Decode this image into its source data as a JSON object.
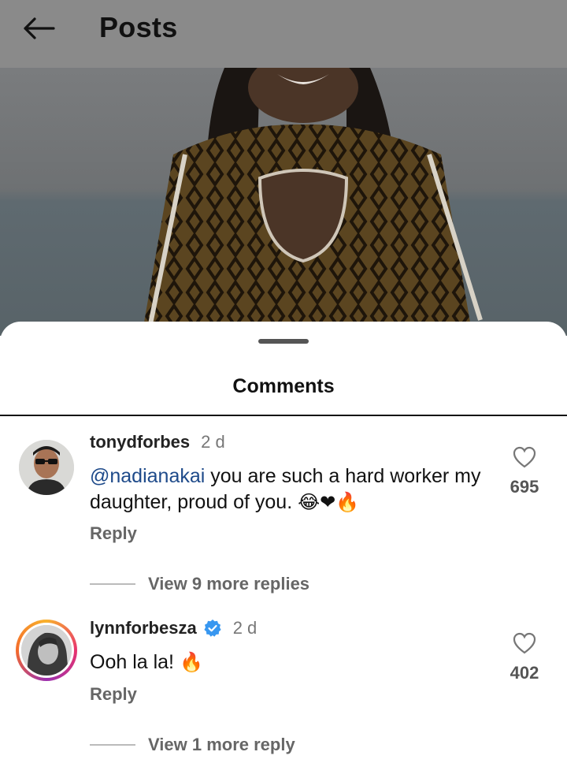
{
  "header": {
    "title": "Posts",
    "back_icon": "arrow-left-icon"
  },
  "sheet": {
    "title": "Comments"
  },
  "comments": [
    {
      "username": "tonydforbes",
      "time": "2 d",
      "mention": "@nadianakai",
      "text": " you are such a hard worker my daughter, proud of you. ",
      "emojis": "😂❤🔥",
      "reply_label": "Reply",
      "likes": "695",
      "view_replies": "View 9 more replies",
      "verified": false
    },
    {
      "username": "lynnforbesza",
      "time": "2 d",
      "mention": "",
      "text": "Ooh la la! ",
      "emojis": "🔥",
      "reply_label": "Reply",
      "likes": "402",
      "view_replies": "View 1 more reply",
      "verified": true
    }
  ],
  "colors": {
    "header_bg": "#8a8a8a",
    "mention": "#1e4a8a",
    "verified": "#3897f0"
  }
}
